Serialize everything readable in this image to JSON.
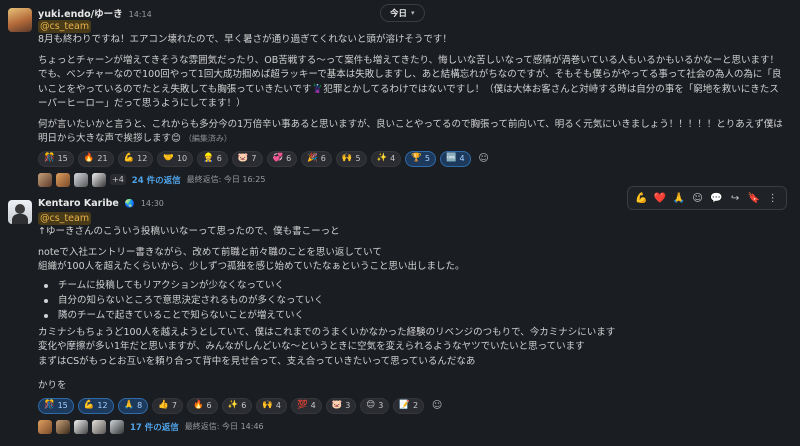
{
  "date_divider": {
    "label": "今日",
    "chevron": "chevron-down-icon"
  },
  "messages": [
    {
      "username": "yuki.endo/ゆーき",
      "time": "14:14",
      "mention": "@cs_team",
      "lines": [
        "8月も終わりですね！エアコン壊れたので、早く暑さが通り過ぎてくれないと頭が溶けそうです！",
        "ちょっとチャーンが増えてきそうな雰囲気だったり、OB苦戦する〜って案件も増えてきたり、悔しいな苦しいなって感情が渦巻いている人もいるかもいるかなーと思います！でも、ベンチャーなので100回やって1回大成功掴めば超ラッキーで基本は失敗しますし、あと結構忘れがちなのですが、そもそも僕らがやってる事って社会の為人の為に「良いことをやっているのでたとえ失敗しても胸張っていきたいです🦹犯罪とかしてるわけではないですし！（僕は大体お客さんと対峙する時は自分の事を「窮地を救いにきたスーパーヒーロー」だって思うようにしてます！）",
        "何が言いたいかと言うと、これからも多分今の1万倍辛い事あると思いますが、良いことやってるので胸張って前向いて、明るく元気にいきましょう！！！！！とりあえず僕は明日から大きな声で挨拶します😊"
      ],
      "edited": "（編集済み）",
      "reactions": [
        {
          "emoji": "🎊",
          "count": "15",
          "mine": false
        },
        {
          "emoji": "🔥",
          "count": "21",
          "mine": false
        },
        {
          "emoji": "💪",
          "count": "12",
          "mine": false
        },
        {
          "emoji": "🤝",
          "count": "10",
          "mine": false
        },
        {
          "emoji": "👷",
          "count": "6",
          "mine": false
        },
        {
          "emoji": "🐷",
          "count": "7",
          "mine": false
        },
        {
          "emoji": "💞",
          "count": "6",
          "mine": false
        },
        {
          "emoji": "🎉",
          "count": "6",
          "mine": false
        },
        {
          "emoji": "🙌",
          "count": "5",
          "mine": false
        },
        {
          "emoji": "✨",
          "count": "4",
          "mine": false
        },
        {
          "emoji": "🏆",
          "count": "5",
          "mine": true
        },
        {
          "emoji": "🆒",
          "count": "4",
          "mine": true
        }
      ],
      "thread": {
        "replies": "24 件の返信",
        "last": "最終返信: 今日 16:25",
        "plus": "+4"
      }
    },
    {
      "username": "Kentaro Karibe",
      "status_emoji": "🌏",
      "time": "14:30",
      "mention": "@cs_team",
      "lines1": [
        "↑ゆーきさんのこういう投稿いいなーって思ったので、僕も書こーっと"
      ],
      "lines2": [
        "noteで入社エントリー書きながら、改めて前職と前々職のことを思い返していて",
        "組織が100人を超えたくらいから、少しずつ孤独を感じ始めていたなぁということ思い出しました。"
      ],
      "bullets": [
        "チームに投稿してもリアクションが少なくなっていく",
        "自分の知らないところで意思決定されるものが多くなっていく",
        "隣のチームで起きていることで知らないことが増えていく"
      ],
      "lines3": [
        "カミナシもちょうど100人を越えようとしていて、僕はこれまでのうまくいかなかった経験のリベンジのつもりで、今カミナシにいます",
        "変化や摩擦が多い1年だと思いますが、みんながしんどいな〜というときに空気を変えられるようなヤツでいたいと思っています",
        "まずはCSがもっとお互いを頼り合って背中を見せ合って、支え合っていきたいって思っているんだなあ"
      ],
      "closing": "かりを",
      "reactions": [
        {
          "emoji": "🎊",
          "count": "15",
          "mine": true
        },
        {
          "emoji": "💪",
          "count": "12",
          "mine": true
        },
        {
          "emoji": "🙏",
          "count": "8",
          "mine": true
        },
        {
          "emoji": "👍",
          "count": "7",
          "mine": false
        },
        {
          "emoji": "🔥",
          "count": "6",
          "mine": false
        },
        {
          "emoji": "✨",
          "count": "6",
          "mine": false
        },
        {
          "emoji": "🙌",
          "count": "4",
          "mine": false
        },
        {
          "emoji": "💯",
          "count": "4",
          "mine": false
        },
        {
          "emoji": "🐷",
          "count": "3",
          "mine": false
        },
        {
          "emoji": "😊",
          "count": "3",
          "mine": false
        },
        {
          "emoji": "📝",
          "count": "2",
          "mine": false
        }
      ],
      "thread": {
        "replies": "17 件の返信",
        "last": "最終返信: 今日 14:46"
      }
    }
  ],
  "hover_toolbar": [
    {
      "name": "muscle-reaction-icon",
      "glyph": "💪"
    },
    {
      "name": "heart-reaction-icon",
      "glyph": "❤️"
    },
    {
      "name": "pray-reaction-icon",
      "glyph": "🙏"
    },
    {
      "name": "add-reaction-icon",
      "glyph": "☺"
    },
    {
      "name": "reply-thread-icon",
      "glyph": "💬"
    },
    {
      "name": "share-icon",
      "glyph": "↪"
    },
    {
      "name": "bookmark-icon",
      "glyph": "🔖"
    },
    {
      "name": "more-actions-icon",
      "glyph": "⋮"
    }
  ],
  "colors": {
    "background": "#1a1d21",
    "text": "#d1d2d3",
    "mention_bg": "#4a3b18",
    "mention_fg": "#e8b34a",
    "link": "#4fa3e8",
    "own_reaction_bg": "#1d3a5c"
  }
}
